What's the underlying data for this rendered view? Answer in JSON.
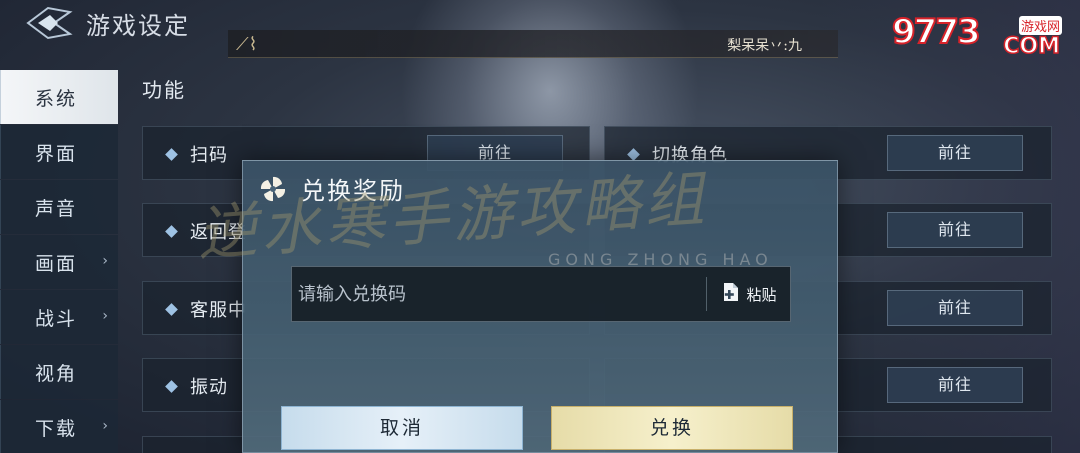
{
  "header": {
    "title": "游戏设定",
    "player_name": "梨呆呆丷:九"
  },
  "watermark": {
    "number": "9773",
    "site": "游戏网",
    "domain": "COM"
  },
  "sidebar": {
    "items": [
      {
        "label": "系统",
        "active": true,
        "arrow": ""
      },
      {
        "label": "界面",
        "active": false,
        "arrow": ""
      },
      {
        "label": "声音",
        "active": false,
        "arrow": ""
      },
      {
        "label": "画面",
        "active": false,
        "arrow": "›"
      },
      {
        "label": "战斗",
        "active": false,
        "arrow": "›"
      },
      {
        "label": "视角",
        "active": false,
        "arrow": ""
      },
      {
        "label": "下载",
        "active": false,
        "arrow": "›"
      }
    ]
  },
  "main": {
    "section_title": "功能",
    "left_rows": [
      {
        "label": "扫码",
        "button": "前往"
      },
      {
        "label": "返回登",
        "button": ""
      },
      {
        "label": "客服中",
        "button": ""
      },
      {
        "label": "振动",
        "button": ""
      }
    ],
    "right_rows": [
      {
        "label": "切换角色",
        "button": "前往"
      },
      {
        "label": "",
        "button": "前往"
      },
      {
        "label": "",
        "button": "前往"
      },
      {
        "label": "",
        "button": "前往"
      }
    ]
  },
  "overlay": {
    "promo_text": "逆水寒手游攻略组",
    "promo_sub": "GONG ZHONG HAO"
  },
  "dialog": {
    "title": "兑换奖励",
    "input_placeholder": "请输入兑换码",
    "input_value": "",
    "paste_label": "粘贴",
    "cancel_label": "取消",
    "confirm_label": "兑换"
  },
  "colors": {
    "accent_blue": "#9ec2e4",
    "cancel_bg": "#d8e8f4",
    "confirm_bg": "#f0e8bc",
    "watermark_red": "#d8232a"
  }
}
